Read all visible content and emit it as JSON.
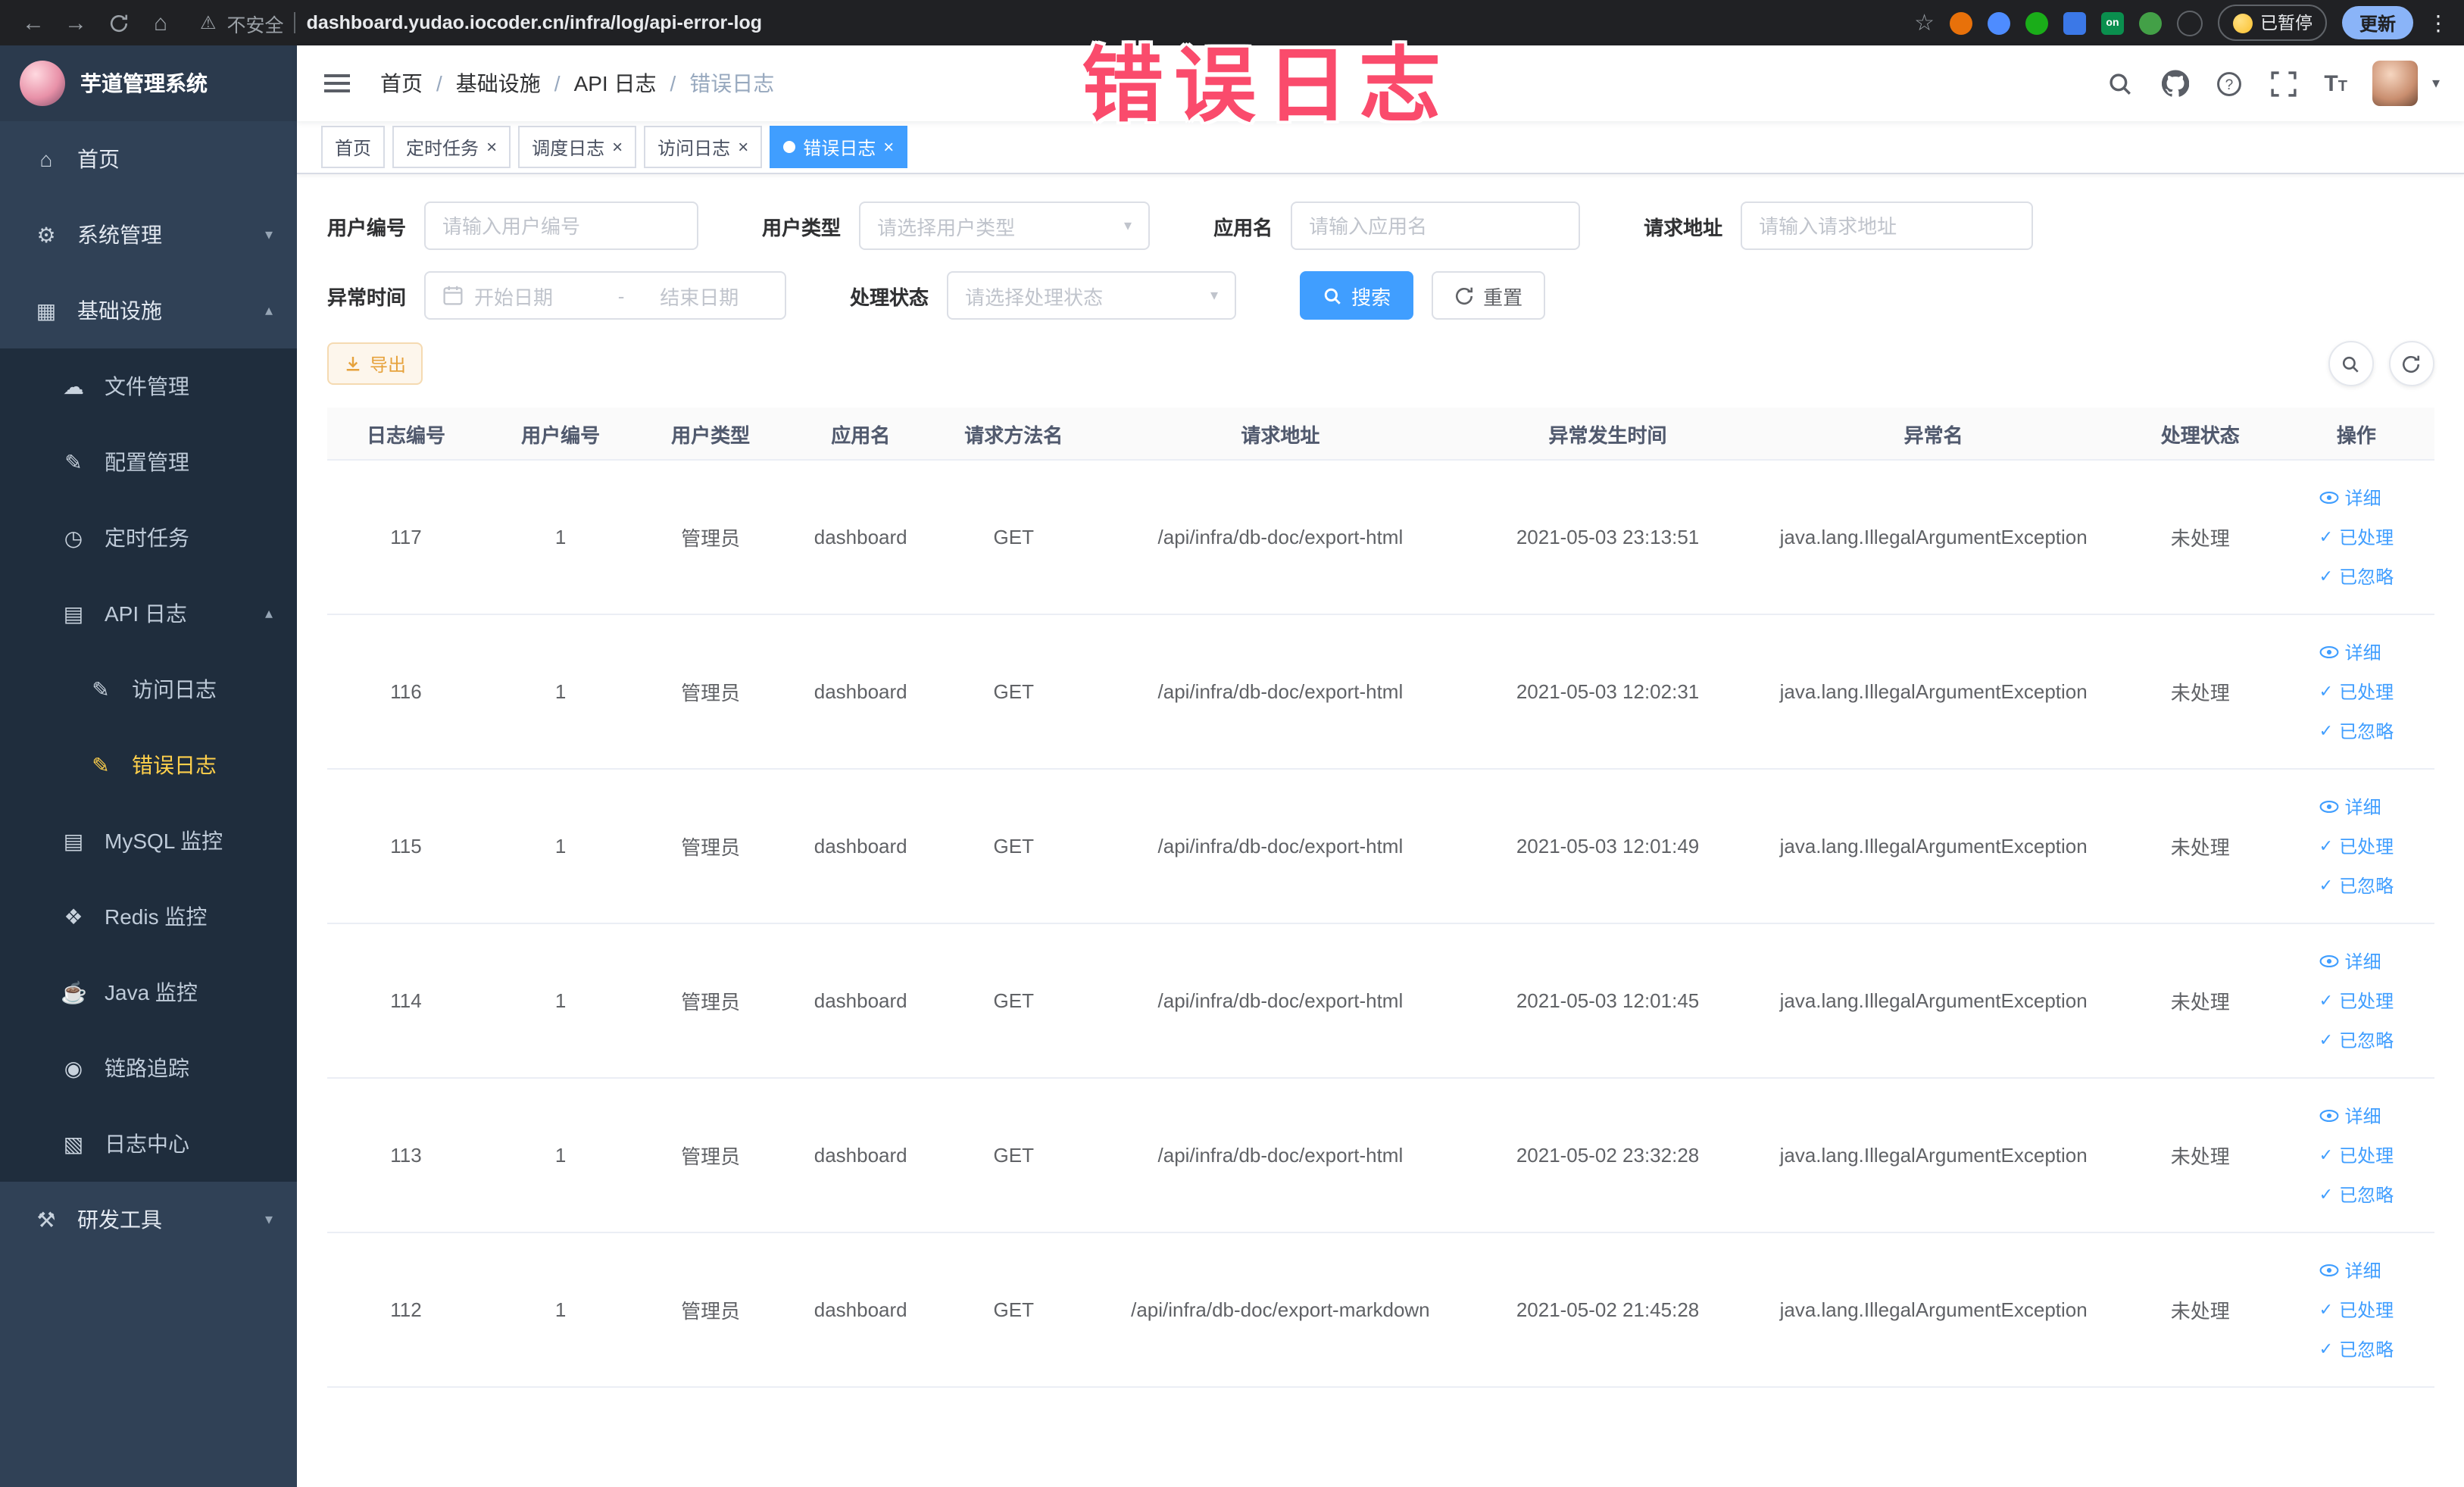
{
  "browser": {
    "security_label": "不安全",
    "url": "dashboard.yudao.iocoder.cn/infra/log/api-error-log",
    "paused_badge": "已暂停",
    "update_button": "更新"
  },
  "annotation": {
    "text": "错误日志"
  },
  "colors": {
    "accent_blue": "#409eff",
    "sidebar_bg": "#304156",
    "submenu_bg": "#1f2d3d",
    "active_gold": "#ffd04b",
    "annotation_pink": "#fa4b6c",
    "warning_orange": "#e6a23c"
  },
  "sidebar": {
    "logo_title": "芋道管理系统",
    "items": [
      {
        "label": "首页"
      },
      {
        "label": "系统管理"
      },
      {
        "label": "基础设施"
      },
      {
        "label": "文件管理"
      },
      {
        "label": "配置管理"
      },
      {
        "label": "定时任务"
      },
      {
        "label": "API 日志"
      },
      {
        "label": "访问日志"
      },
      {
        "label": "错误日志"
      },
      {
        "label": "MySQL 监控"
      },
      {
        "label": "Redis 监控"
      },
      {
        "label": "Java 监控"
      },
      {
        "label": "链路追踪"
      },
      {
        "label": "日志中心"
      },
      {
        "label": "研发工具"
      }
    ]
  },
  "breadcrumb": {
    "items": [
      "首页",
      "基础设施",
      "API 日志",
      "错误日志"
    ]
  },
  "tags": [
    {
      "label": "首页"
    },
    {
      "label": "定时任务"
    },
    {
      "label": "调度日志"
    },
    {
      "label": "访问日志"
    },
    {
      "label": "错误日志"
    }
  ],
  "filters": {
    "user_id": {
      "label": "用户编号",
      "placeholder": "请输入用户编号"
    },
    "user_type": {
      "label": "用户类型",
      "placeholder": "请选择用户类型"
    },
    "app_name": {
      "label": "应用名",
      "placeholder": "请输入应用名"
    },
    "request_url": {
      "label": "请求地址",
      "placeholder": "请输入请求地址"
    },
    "exception_time": {
      "label": "异常时间",
      "start_placeholder": "开始日期",
      "separator": "-",
      "end_placeholder": "结束日期"
    },
    "process_status": {
      "label": "处理状态",
      "placeholder": "请选择处理状态"
    },
    "search_label": "搜索",
    "reset_label": "重置"
  },
  "toolbar": {
    "export_label": "导出"
  },
  "table": {
    "columns": [
      "日志编号",
      "用户编号",
      "用户类型",
      "应用名",
      "请求方法名",
      "请求地址",
      "异常发生时间",
      "异常名",
      "处理状态",
      "操作"
    ],
    "actions": {
      "detail": "详细",
      "processed": "已处理",
      "ignored": "已忽略"
    },
    "rows": [
      {
        "id": "117",
        "user_id": "1",
        "user_type": "管理员",
        "app": "dashboard",
        "method": "GET",
        "url": "/api/infra/db-doc/export-html",
        "time": "2021-05-03 23:13:51",
        "exception": "java.lang.IllegalArgumentException",
        "status": "未处理"
      },
      {
        "id": "116",
        "user_id": "1",
        "user_type": "管理员",
        "app": "dashboard",
        "method": "GET",
        "url": "/api/infra/db-doc/export-html",
        "time": "2021-05-03 12:02:31",
        "exception": "java.lang.IllegalArgumentException",
        "status": "未处理"
      },
      {
        "id": "115",
        "user_id": "1",
        "user_type": "管理员",
        "app": "dashboard",
        "method": "GET",
        "url": "/api/infra/db-doc/export-html",
        "time": "2021-05-03 12:01:49",
        "exception": "java.lang.IllegalArgumentException",
        "status": "未处理"
      },
      {
        "id": "114",
        "user_id": "1",
        "user_type": "管理员",
        "app": "dashboard",
        "method": "GET",
        "url": "/api/infra/db-doc/export-html",
        "time": "2021-05-03 12:01:45",
        "exception": "java.lang.IllegalArgumentException",
        "status": "未处理"
      },
      {
        "id": "113",
        "user_id": "1",
        "user_type": "管理员",
        "app": "dashboard",
        "method": "GET",
        "url": "/api/infra/db-doc/export-html",
        "time": "2021-05-02 23:32:28",
        "exception": "java.lang.IllegalArgumentException",
        "status": "未处理"
      },
      {
        "id": "112",
        "user_id": "1",
        "user_type": "管理员",
        "app": "dashboard",
        "method": "GET",
        "url": "/api/infra/db-doc/export-markdown",
        "time": "2021-05-02 21:45:28",
        "exception": "java.lang.IllegalArgumentException",
        "status": "未处理"
      }
    ]
  }
}
